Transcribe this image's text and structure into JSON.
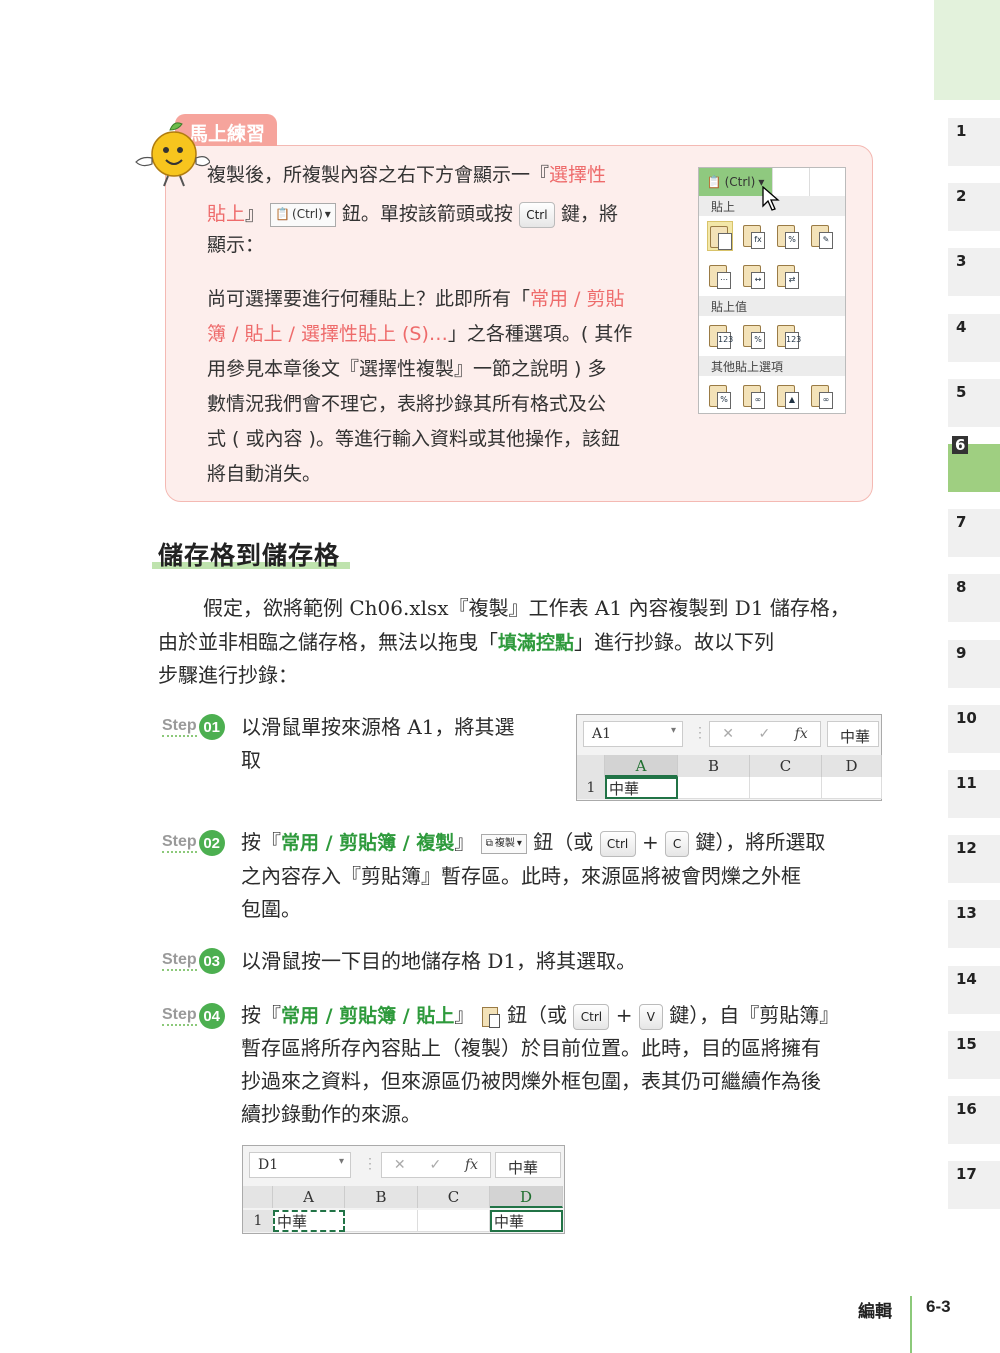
{
  "chapters": [
    "1",
    "2",
    "3",
    "4",
    "5",
    "6",
    "7",
    "8",
    "9",
    "10",
    "11",
    "12",
    "13",
    "14",
    "15",
    "16",
    "17"
  ],
  "active_chapter": "6",
  "practice": {
    "label": "馬上練習",
    "line1": "複製後，所複製內容之右下方會顯示一『",
    "line1_hl": "選擇性",
    "line2_hl": "貼上",
    "line2_a": "』",
    "ctrl_btn": "(Ctrl)",
    "line2_b": "鈕。單按該箭頭或按",
    "key_ctrl": "Ctrl",
    "line2_c": "鍵，將",
    "line3": "顯示：",
    "para2_l1a": "尚可選擇要進行何種貼上？此即所有「",
    "para2_l1hl": "常用 / 剪貼",
    "para2_l2hl": "簿 / 貼上 / 選擇性貼上 (S)…",
    "para2_l2b": "」之各種選項。( 其作",
    "para2_l3": "用參見本章後文『選擇性複製』一節之說明 ) 多",
    "para2_l4": "數情況我們會不理它，表將抄錄其所有格式及公",
    "para2_l5": "式 ( 或內容 )。等進行輸入資料或其他操作，該鈕",
    "para2_l6": "將自動消失。"
  },
  "paste_panel": {
    "ctrl_label": "(Ctrl)",
    "sec1": "貼上",
    "sec2": "貼上值",
    "sec3": "其他貼上選項"
  },
  "section": {
    "title": "儲存格到儲存格",
    "para_l1": "假定，欲將範例 Ch06.xlsx『複製』工作表 A1 內容複製到 D1 儲存格，",
    "para_l2a": "由於並非相臨之儲存格，無法以拖曳「",
    "para_l2hl": "填滿控點",
    "para_l2b": "」進行抄錄。故以下列",
    "para_l3": "步驟進行抄錄："
  },
  "steps": [
    {
      "word": "Step",
      "num": "01",
      "l1": "以滑鼠單按來源格 A1，將其選",
      "l2": "取"
    },
    {
      "word": "Step",
      "num": "02",
      "l1a": "按『",
      "l1hl": "常用 / 剪貼簿 / 複製",
      "l1b": "』",
      "btn": "複製",
      "l1c": "鈕（或",
      "key1": "Ctrl",
      "plus": "+",
      "key2": "C",
      "l1d": "鍵），將所選取",
      "l2": "之內容存入『剪貼簿』暫存區。此時，來源區將被會閃爍之外框",
      "l3": "包圍。"
    },
    {
      "word": "Step",
      "num": "03",
      "l1": "以滑鼠按一下目的地儲存格 D1，將其選取。"
    },
    {
      "word": "Step",
      "num": "04",
      "l1a": "按『",
      "l1hl": "常用 / 剪貼簿 / 貼上",
      "l1b": "』",
      "l1c": "鈕（或",
      "key1": "Ctrl",
      "plus": "+",
      "key2": "V",
      "l1d": "鍵），自『剪貼簿』",
      "l2": "暫存區將所存內容貼上（複製）於目前位置。此時，目的區將擁有",
      "l3": "抄過來之資料，但來源區仍被閃爍外框包圍，表其仍可繼續作為後",
      "l4": "續抄錄動作的來源。"
    }
  ],
  "excel1": {
    "name_box": "A1",
    "formula_value": "中華",
    "columns": [
      "A",
      "B",
      "C",
      "D"
    ],
    "row_num": "1",
    "cell_a1": "中華"
  },
  "excel2": {
    "name_box": "D1",
    "formula_value": "中華",
    "columns": [
      "A",
      "B",
      "C",
      "D"
    ],
    "row_num": "1",
    "cell_a1": "中華",
    "cell_d1": "中華"
  },
  "footer": {
    "label": "編輯",
    "page": "6-3"
  },
  "colors": {
    "accent_green": "#4caf50",
    "highlight_red": "#ee6b6b",
    "practice_bg": "#fdeeec"
  }
}
